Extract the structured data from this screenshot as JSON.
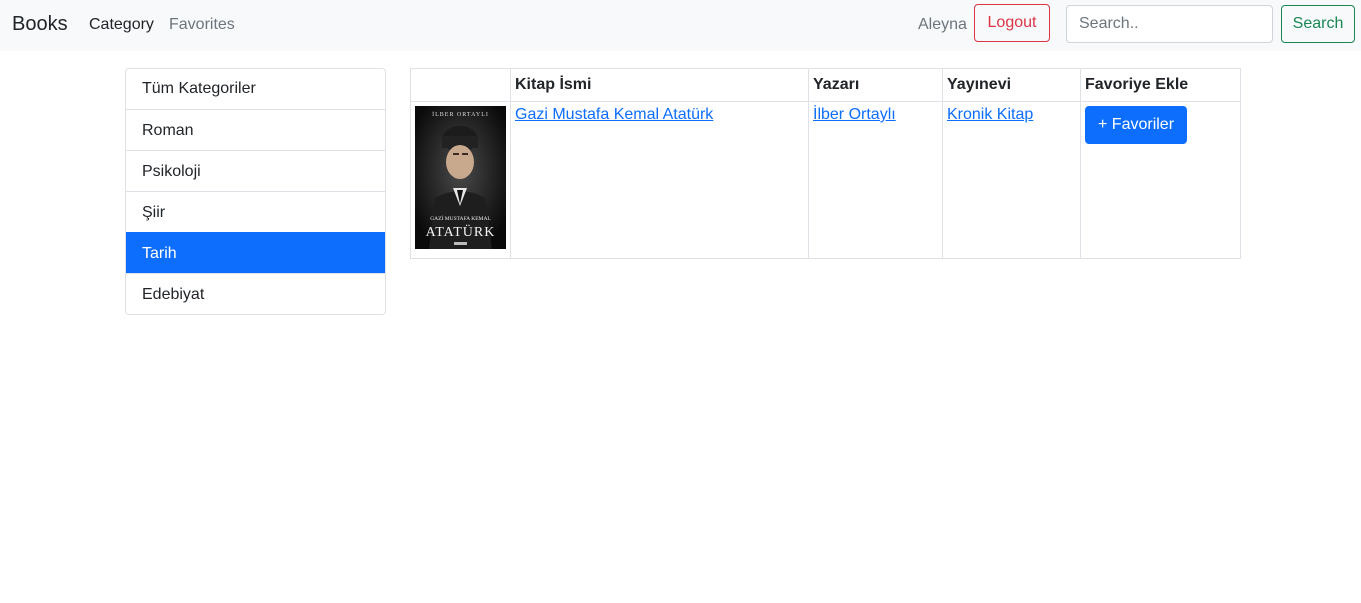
{
  "navbar": {
    "brand": "Books",
    "links": {
      "category": "Category",
      "favorites": "Favorites"
    },
    "username": "Aleyna",
    "logout_label": "Logout",
    "search_placeholder": "Search..",
    "search_label": "Search"
  },
  "sidebar": {
    "items": [
      {
        "label": "Tüm Kategoriler",
        "active": false
      },
      {
        "label": "Roman",
        "active": false
      },
      {
        "label": "Psikoloji",
        "active": false
      },
      {
        "label": "Şiir",
        "active": false
      },
      {
        "label": "Tarih",
        "active": true
      },
      {
        "label": "Edebiyat",
        "active": false
      }
    ]
  },
  "table": {
    "headers": [
      "",
      "Kitap İsmi",
      "Yazarı",
      "Yayınevi",
      "Favoriye Ekle"
    ],
    "rows": [
      {
        "cover": {
          "top_text": "İLBER ORTAYLI",
          "sub_text": "GAZİ MUSTAFA KEMAL",
          "main_text": "ATATÜRK"
        },
        "title": "Gazi Mustafa Kemal Atatürk",
        "author": "İlber Ortaylı",
        "publisher": "Kronik Kitap",
        "fav_label": "+ Favoriler"
      }
    ]
  },
  "colors": {
    "primary": "#0d6efd",
    "danger": "#dc3545",
    "success": "#198754",
    "navbar_bg": "#f8f9fa"
  }
}
